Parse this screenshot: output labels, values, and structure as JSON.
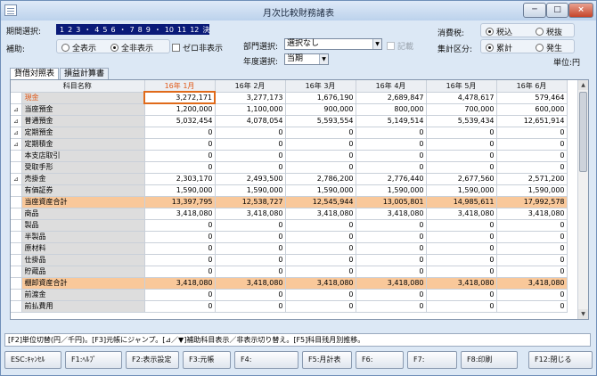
{
  "window": {
    "title": "月次比較財務諸表",
    "controls": {
      "minimize": "─",
      "maximize": "□",
      "close": "×"
    }
  },
  "filters": {
    "period_label": "期間選択:",
    "period_months": [
      "1",
      "2",
      "3",
      "・",
      "4",
      "5",
      "6",
      "・",
      "7",
      "8",
      "9",
      "・",
      "10",
      "11",
      "12",
      "決"
    ],
    "display_label": "補助:",
    "display_options": [
      {
        "label": "全表示",
        "selected": false
      },
      {
        "label": "全非表示",
        "selected": true
      }
    ],
    "zero_hide_label": "ゼロ非表示",
    "dept_label": "部門選択:",
    "dept_value": "選択なし",
    "detail_label": "記載",
    "year_label": "年度選択:",
    "year_value": "当期",
    "tax_label": "消費税:",
    "tax_options": [
      {
        "label": "税込",
        "selected": true
      },
      {
        "label": "税抜",
        "selected": false
      }
    ],
    "agg_label": "集計区分:",
    "agg_options": [
      {
        "label": "累計",
        "selected": true
      },
      {
        "label": "発生",
        "selected": false
      }
    ],
    "unit_label": "単位:円"
  },
  "tabs": [
    {
      "label": "貸借対照表",
      "active": true
    },
    {
      "label": "損益計算書",
      "active": false
    }
  ],
  "table": {
    "headers": [
      "科目名称",
      "16年 1月",
      "16年 2月",
      "16年 3月",
      "16年 4月",
      "16年 5月",
      "16年 6月"
    ],
    "current_month_index": 1,
    "rows": [
      {
        "exp": "",
        "name": "現金",
        "values": [
          "3,272,171",
          "3,277,173",
          "1,676,190",
          "2,689,847",
          "4,478,617",
          "579,464"
        ],
        "sub": false
      },
      {
        "exp": "⊿",
        "name": "当座預金",
        "values": [
          "1,200,000",
          "1,100,000",
          "900,000",
          "800,000",
          "700,000",
          "600,000"
        ],
        "sub": false
      },
      {
        "exp": "⊿",
        "name": "普通預金",
        "values": [
          "5,032,454",
          "4,078,054",
          "5,593,554",
          "5,149,514",
          "5,539,434",
          "12,651,914"
        ],
        "sub": false
      },
      {
        "exp": "⊿",
        "name": "定期預金",
        "values": [
          "0",
          "0",
          "0",
          "0",
          "0",
          "0"
        ],
        "sub": false
      },
      {
        "exp": "⊿",
        "name": "定期積金",
        "values": [
          "0",
          "0",
          "0",
          "0",
          "0",
          "0"
        ],
        "sub": false
      },
      {
        "exp": "",
        "name": "本支店取引",
        "values": [
          "0",
          "0",
          "0",
          "0",
          "0",
          "0"
        ],
        "sub": false
      },
      {
        "exp": "",
        "name": "受取手形",
        "values": [
          "0",
          "0",
          "0",
          "0",
          "0",
          "0"
        ],
        "sub": false
      },
      {
        "exp": "⊿",
        "name": "売掛金",
        "values": [
          "2,303,170",
          "2,493,500",
          "2,786,200",
          "2,776,440",
          "2,677,560",
          "2,571,200"
        ],
        "sub": false
      },
      {
        "exp": "",
        "name": "有価証券",
        "values": [
          "1,590,000",
          "1,590,000",
          "1,590,000",
          "1,590,000",
          "1,590,000",
          "1,590,000"
        ],
        "sub": false
      },
      {
        "exp": "",
        "name": "当座資産合計",
        "values": [
          "13,397,795",
          "12,538,727",
          "12,545,944",
          "13,005,801",
          "14,985,611",
          "17,992,578"
        ],
        "sub": true
      },
      {
        "exp": "",
        "name": "商品",
        "values": [
          "3,418,080",
          "3,418,080",
          "3,418,080",
          "3,418,080",
          "3,418,080",
          "3,418,080"
        ],
        "sub": false
      },
      {
        "exp": "",
        "name": "製品",
        "values": [
          "0",
          "0",
          "0",
          "0",
          "0",
          "0"
        ],
        "sub": false
      },
      {
        "exp": "",
        "name": "半製品",
        "values": [
          "0",
          "0",
          "0",
          "0",
          "0",
          "0"
        ],
        "sub": false
      },
      {
        "exp": "",
        "name": "原材料",
        "values": [
          "0",
          "0",
          "0",
          "0",
          "0",
          "0"
        ],
        "sub": false
      },
      {
        "exp": "",
        "name": "仕掛品",
        "values": [
          "0",
          "0",
          "0",
          "0",
          "0",
          "0"
        ],
        "sub": false
      },
      {
        "exp": "",
        "name": "貯蔵品",
        "values": [
          "0",
          "0",
          "0",
          "0",
          "0",
          "0"
        ],
        "sub": false
      },
      {
        "exp": "",
        "name": "棚卸資産合計",
        "values": [
          "3,418,080",
          "3,418,080",
          "3,418,080",
          "3,418,080",
          "3,418,080",
          "3,418,080"
        ],
        "sub": true
      },
      {
        "exp": "",
        "name": "前渡金",
        "values": [
          "0",
          "0",
          "0",
          "0",
          "0",
          "0"
        ],
        "sub": false
      },
      {
        "exp": "",
        "name": "前払費用",
        "values": [
          "0",
          "0",
          "0",
          "0",
          "0",
          "0"
        ],
        "sub": false
      }
    ]
  },
  "hint_text": "[F2]単位切替(円／千円)。[F3]元帳にジャンプ。[⊿／▼]補助科目表示／非表示切り替え。[F5]科目残月別推移。",
  "fkeys": [
    "ESC:ｷｬﾝｾﾙ",
    "F1:ﾍﾙﾌﾟ",
    "F2:表示設定",
    "F3:元帳",
    "F4:",
    "F5:月計表",
    "F6:",
    "F7:",
    "F8:印刷",
    "F12:閉じる"
  ]
}
